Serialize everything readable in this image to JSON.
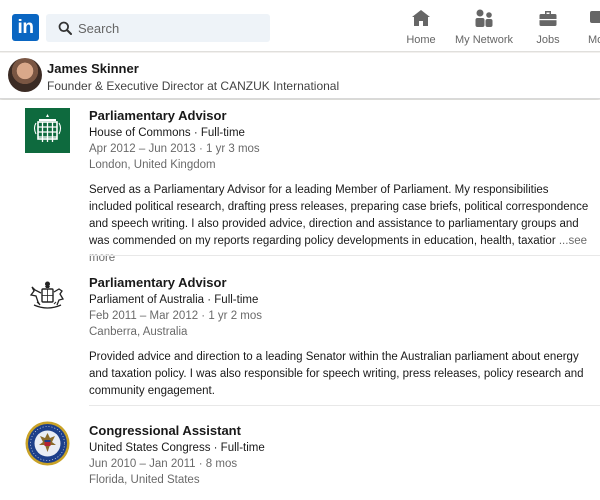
{
  "nav": {
    "logo_text": "in",
    "search_placeholder": "Search",
    "items": [
      {
        "label": "Home",
        "icon": "home-icon"
      },
      {
        "label": "My Network",
        "icon": "network-icon"
      },
      {
        "label": "Jobs",
        "icon": "briefcase-icon"
      },
      {
        "label": "Mo",
        "icon": "messaging-icon"
      }
    ],
    "brand_color": "#0a66c2"
  },
  "profile": {
    "name": "James Skinner",
    "headline": "Founder & Executive Director at CANZUK International"
  },
  "experience": [
    {
      "title": "Parliamentary Advisor",
      "org": "House of Commons · Full-time",
      "dates": "Apr 2012 – Jun 2013 · 1 yr 3 mos",
      "location": "London, United Kingdom",
      "description": "Served as a Parliamentary Advisor for a leading Member of Parliament. My responsibilities included political research, drafting press releases, preparing case briefs, political correspondence and speech writing. I also provided advice, direction and assistance to parliamentary groups and was commended on my reports regarding policy developments in education, health, taxatior",
      "see_more": "...see more",
      "emblem": "portcullis-icon"
    },
    {
      "title": "Parliamentary Advisor",
      "org": "Parliament of Australia · Full-time",
      "dates": "Feb 2011 – Mar 2012 · 1 yr 2 mos",
      "location": "Canberra, Australia",
      "description": "Provided advice and direction to a leading Senator within the Australian parliament about energy and taxation policy. I was also responsible for speech writing, press releases, policy research and community engagement.",
      "emblem": "coat-of-arms-icon"
    },
    {
      "title": "Congressional Assistant",
      "org": "United States Congress · Full-time",
      "dates": "Jun 2010 – Jan 2011 · 8 mos",
      "location": "Florida, United States",
      "emblem": "congress-seal-icon"
    }
  ]
}
